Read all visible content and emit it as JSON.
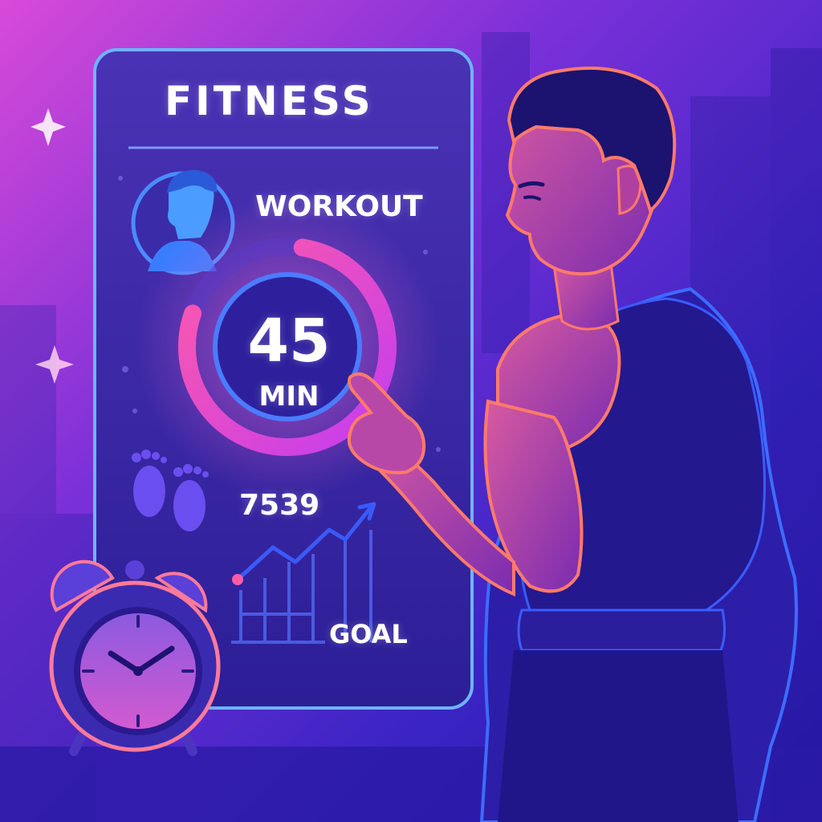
{
  "colors": {
    "background_top": "#c23ad6",
    "background_bottom": "#2f1fb8",
    "panel": "#3a2a9a",
    "panel_border": "#5fa8ff",
    "ring_pink": "#ff4fb0",
    "ring_purple": "#9a4cff",
    "skin": "#c24fa6",
    "outline": "#ff7a6a",
    "text": "#ffffff"
  },
  "panel": {
    "title": "FITNESS",
    "workout_label": "WORKOUT",
    "minutes_value": "45",
    "minutes_unit": "MIN",
    "minutes_progress": 0.78,
    "steps_value": "7539",
    "goal_label": "GOAL"
  },
  "icons": {
    "avatar": "person-avatar-icon",
    "footprints": "footprints-icon",
    "trend": "trend-chart-icon",
    "clock": "alarm-clock-icon",
    "sparkle": "sparkle-icon"
  }
}
